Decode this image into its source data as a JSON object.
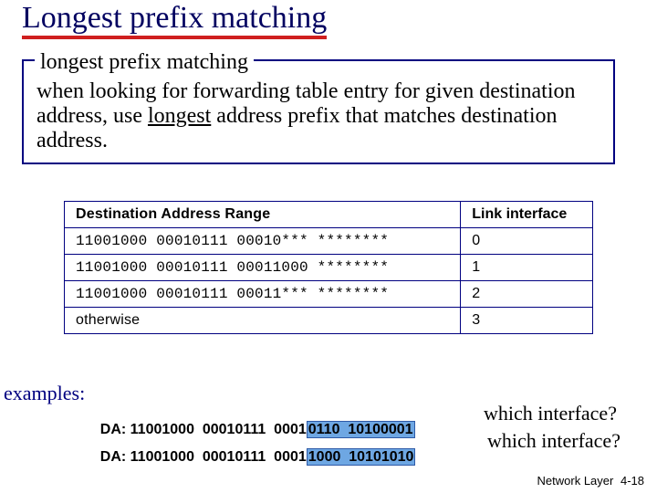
{
  "title": "Longest prefix matching",
  "def": {
    "legend": "longest prefix matching",
    "text_pre": "when looking for forwarding table entry for given destination address, use ",
    "text_u": "longest",
    "text_post": " address prefix that matches destination address."
  },
  "table": {
    "headers": {
      "dest": "Destination Address Range",
      "iface": "Link interface"
    },
    "rows": [
      {
        "dest": "11001000 00010111 00010*** ********",
        "iface": "0"
      },
      {
        "dest": "11001000 00010111 00011000 ********",
        "iface": "1"
      },
      {
        "dest": "11001000 00010111 00011*** ********",
        "iface": "2"
      },
      {
        "dest": "otherwise",
        "iface": "3",
        "other": true
      }
    ]
  },
  "examples": {
    "label": "examples:",
    "ex1": {
      "prefix": "DA: 11001000  00010111  0001",
      "hl": "0110  10100001"
    },
    "ex2": {
      "prefix": "DA: 11001000  00010111  0001",
      "hl": "1000  10101010"
    },
    "q": "which interface?"
  },
  "footer": {
    "label": "Network Layer",
    "page": "4-18"
  }
}
